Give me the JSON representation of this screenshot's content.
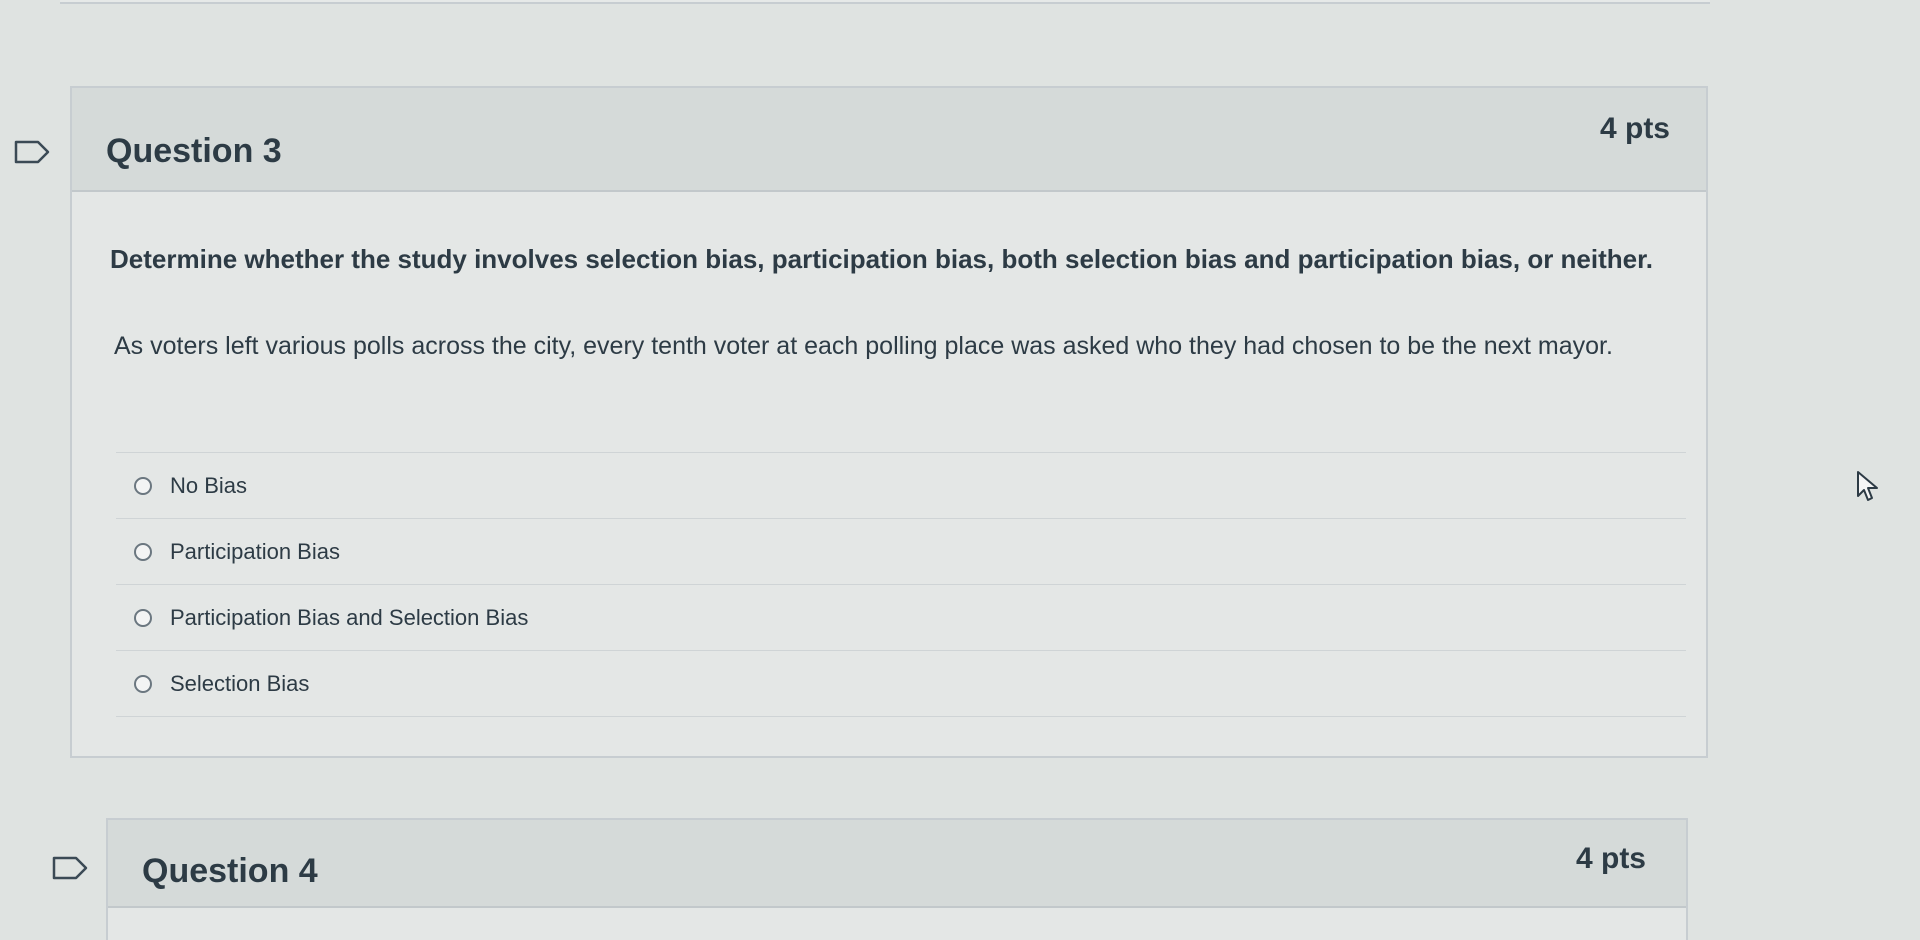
{
  "question3": {
    "title": "Question 3",
    "points": "4 pts",
    "prompt": "Determine whether the study involves selection bias, participation bias, both selection bias and participation bias, or neither.",
    "scenario": "As voters left various polls across the city, every tenth voter at each polling place was asked who they had chosen to be the next mayor.",
    "answers": [
      {
        "label": "No Bias"
      },
      {
        "label": "Participation Bias"
      },
      {
        "label": "Participation Bias and Selection Bias"
      },
      {
        "label": "Selection Bias"
      }
    ]
  },
  "question4": {
    "title": "Question 4",
    "points": "4 pts"
  },
  "icons": {
    "flag": "flag-question-icon",
    "cursor": "mouse-pointer-icon"
  },
  "colors": {
    "header_bg": "#d5dad9",
    "body_bg": "#e4e7e6",
    "text": "#2d3b45",
    "border": "#c7cdd1"
  }
}
